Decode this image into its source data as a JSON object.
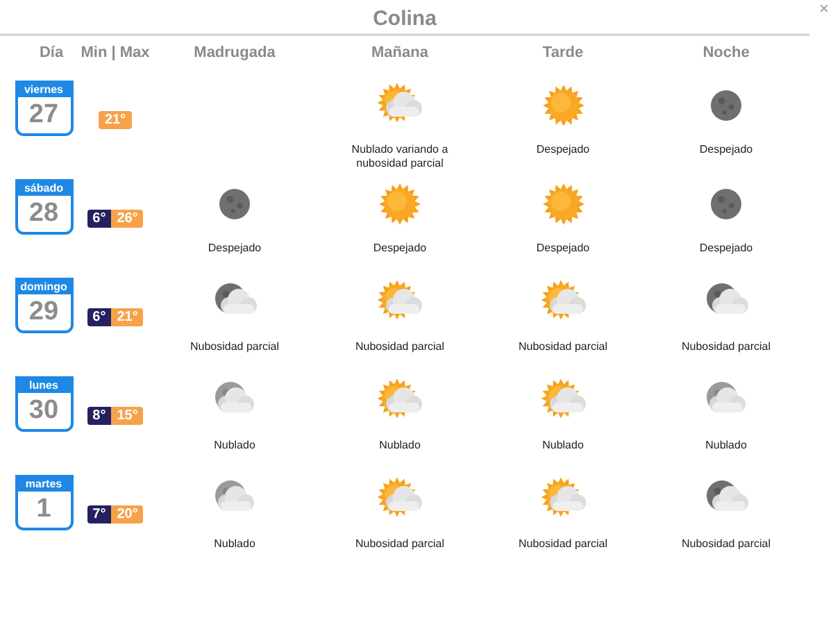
{
  "title": "Colina",
  "close": "×",
  "columns": [
    "Día",
    "Min | Max",
    "Madrugada",
    "Mañana",
    "Tarde",
    "Noche"
  ],
  "days": [
    {
      "weekday": "viernes",
      "date": "27",
      "max": "21°",
      "periods": [
        {
          "kind": "none"
        },
        {
          "kind": "partly_day",
          "text": "Nublado variando a nubosidad parcial"
        },
        {
          "kind": "clear_day",
          "text": "Despejado"
        },
        {
          "kind": "clear_night",
          "text": "Despejado"
        }
      ]
    },
    {
      "weekday": "sábado",
      "date": "28",
      "min": "6°",
      "max": "26°",
      "periods": [
        {
          "kind": "clear_night",
          "text": "Despejado"
        },
        {
          "kind": "clear_day",
          "text": "Despejado"
        },
        {
          "kind": "clear_day",
          "text": "Despejado"
        },
        {
          "kind": "clear_night",
          "text": "Despejado"
        }
      ]
    },
    {
      "weekday": "domingo",
      "date": "29",
      "min": "6°",
      "max": "21°",
      "periods": [
        {
          "kind": "partly_night",
          "text": "Nubosidad parcial"
        },
        {
          "kind": "partly_day",
          "text": "Nubosidad parcial"
        },
        {
          "kind": "partly_day",
          "text": "Nubosidad parcial"
        },
        {
          "kind": "partly_night",
          "text": "Nubosidad parcial"
        }
      ]
    },
    {
      "weekday": "lunes",
      "date": "30",
      "min": "8°",
      "max": "15°",
      "periods": [
        {
          "kind": "cloudy_night",
          "text": "Nublado"
        },
        {
          "kind": "partly_day",
          "text": "Nublado"
        },
        {
          "kind": "partly_day",
          "text": "Nublado"
        },
        {
          "kind": "cloudy_night",
          "text": "Nublado"
        }
      ]
    },
    {
      "weekday": "martes",
      "date": "1",
      "min": "7°",
      "max": "20°",
      "periods": [
        {
          "kind": "cloudy_night",
          "text": "Nublado"
        },
        {
          "kind": "partly_day",
          "text": "Nubosidad parcial"
        },
        {
          "kind": "partly_day",
          "text": "Nubosidad parcial"
        },
        {
          "kind": "partly_night",
          "text": "Nubosidad parcial"
        }
      ]
    }
  ]
}
